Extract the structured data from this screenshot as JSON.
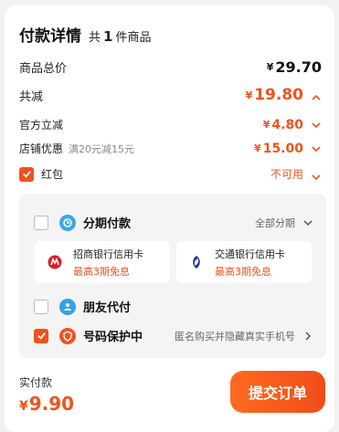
{
  "header": {
    "title": "付款详情",
    "count_prefix": "共",
    "count": "1",
    "count_suffix": "件商品"
  },
  "rows": {
    "total": {
      "label": "商品总价",
      "currency": "¥",
      "amount": "29.70"
    },
    "discount": {
      "label": "共减",
      "currency": "¥",
      "amount": "19.80"
    },
    "official": {
      "label": "官方立减",
      "currency": "¥",
      "amount": "4.80"
    },
    "store": {
      "label": "店铺优惠",
      "sub": "满20元减15元",
      "currency": "¥",
      "amount": "15.00"
    },
    "redpacket": {
      "label": "红包",
      "status": "不可用"
    }
  },
  "payment": {
    "installment": {
      "label": "分期付款",
      "right": "全部分期"
    },
    "cards": [
      {
        "bank": "招商银行信用卡",
        "promo": "最高3期免息"
      },
      {
        "bank": "交通银行信用卡",
        "promo": "最高3期免息"
      }
    ],
    "friend_pay": {
      "label": "朋友代付"
    },
    "number_protect": {
      "label": "号码保护中",
      "right": "匿名购买并隐藏真实手机号"
    }
  },
  "footer": {
    "total_label": "实付款",
    "currency": "¥",
    "total_amount": "9.90",
    "submit_label": "提交订单"
  },
  "colors": {
    "accent": "#f0521e",
    "installment_icon": "#39a8e6",
    "friend_icon": "#35a1e8",
    "protect_icon": "#f0521e"
  }
}
